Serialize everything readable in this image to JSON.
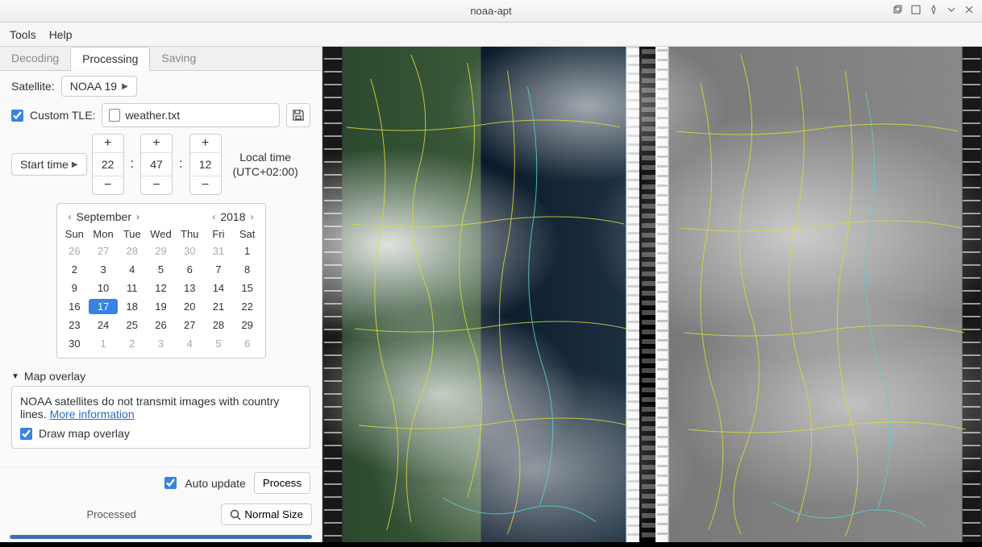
{
  "window": {
    "title": "noaa-apt"
  },
  "menubar": [
    "Tools",
    "Help"
  ],
  "tabs": {
    "items": [
      "Decoding",
      "Processing",
      "Saving"
    ],
    "active": 1
  },
  "satellite": {
    "label": "Satellite:",
    "value": "NOAA 19"
  },
  "custom_tle": {
    "checked": true,
    "label": "Custom TLE:",
    "filename": "weather.txt"
  },
  "start_time": {
    "button": "Start time",
    "hh": "22",
    "mm": "47",
    "ss": "12",
    "tz_line1": "Local time",
    "tz_line2": "(UTC+02:00)"
  },
  "calendar": {
    "month": "September",
    "year": "2018",
    "dow": [
      "Sun",
      "Mon",
      "Tue",
      "Wed",
      "Thu",
      "Fri",
      "Sat"
    ],
    "days": [
      {
        "n": "26",
        "muted": true
      },
      {
        "n": "27",
        "muted": true
      },
      {
        "n": "28",
        "muted": true
      },
      {
        "n": "29",
        "muted": true
      },
      {
        "n": "30",
        "muted": true
      },
      {
        "n": "31",
        "muted": true
      },
      {
        "n": "1"
      },
      {
        "n": "2"
      },
      {
        "n": "3"
      },
      {
        "n": "4"
      },
      {
        "n": "5"
      },
      {
        "n": "6"
      },
      {
        "n": "7"
      },
      {
        "n": "8"
      },
      {
        "n": "9"
      },
      {
        "n": "10"
      },
      {
        "n": "11"
      },
      {
        "n": "12"
      },
      {
        "n": "13"
      },
      {
        "n": "14"
      },
      {
        "n": "15"
      },
      {
        "n": "16"
      },
      {
        "n": "17",
        "sel": true
      },
      {
        "n": "18"
      },
      {
        "n": "19"
      },
      {
        "n": "20"
      },
      {
        "n": "21"
      },
      {
        "n": "22"
      },
      {
        "n": "23"
      },
      {
        "n": "24"
      },
      {
        "n": "25"
      },
      {
        "n": "26"
      },
      {
        "n": "27"
      },
      {
        "n": "28"
      },
      {
        "n": "29"
      },
      {
        "n": "30"
      },
      {
        "n": "1",
        "muted": true
      },
      {
        "n": "2",
        "muted": true
      },
      {
        "n": "3",
        "muted": true
      },
      {
        "n": "4",
        "muted": true
      },
      {
        "n": "5",
        "muted": true
      },
      {
        "n": "6",
        "muted": true
      }
    ]
  },
  "map_overlay": {
    "title": "Map overlay",
    "info_text": "NOAA satellites do not transmit images with country lines. ",
    "link": "More information",
    "draw_checked": true,
    "draw_label": "Draw map overlay"
  },
  "footer": {
    "auto_update_checked": true,
    "auto_update_label": "Auto update",
    "process_label": "Process"
  },
  "status": {
    "text": "Processed",
    "normal_size": "Normal Size"
  }
}
